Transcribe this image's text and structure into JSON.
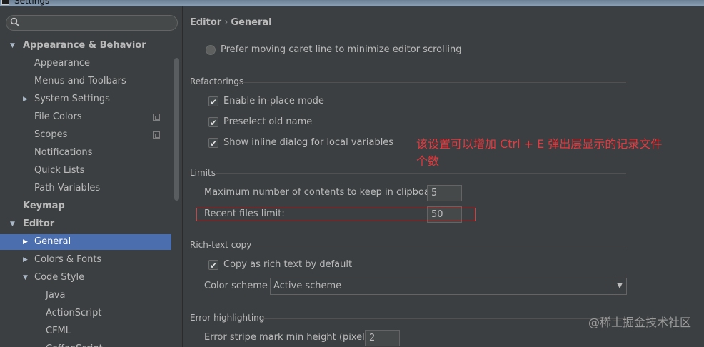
{
  "window": {
    "title": "Settings"
  },
  "search": {
    "placeholder": "",
    "icon": "search-icon"
  },
  "sidebar": {
    "items": [
      {
        "label": "Appearance & Behavior",
        "level": 0,
        "bold": true,
        "arrow": "▼"
      },
      {
        "label": "Appearance",
        "level": 1
      },
      {
        "label": "Menus and Toolbars",
        "level": 1
      },
      {
        "label": "System Settings",
        "level": 1,
        "arrow": "▶"
      },
      {
        "label": "File Colors",
        "level": 1,
        "icon": "copy-icon"
      },
      {
        "label": "Scopes",
        "level": 1,
        "icon": "copy-icon"
      },
      {
        "label": "Notifications",
        "level": 1
      },
      {
        "label": "Quick Lists",
        "level": 1
      },
      {
        "label": "Path Variables",
        "level": 1
      },
      {
        "label": "Keymap",
        "level": 0,
        "bold": true
      },
      {
        "label": "Editor",
        "level": 0,
        "bold": true,
        "arrow": "▼"
      },
      {
        "label": "General",
        "level": 1,
        "arrow": "▶",
        "selected": true
      },
      {
        "label": "Colors & Fonts",
        "level": 1,
        "arrow": "▶"
      },
      {
        "label": "Code Style",
        "level": 1,
        "arrow": "▼"
      },
      {
        "label": "Java",
        "level": 2
      },
      {
        "label": "ActionScript",
        "level": 2
      },
      {
        "label": "CFML",
        "level": 2
      },
      {
        "label": "CoffeeScript",
        "level": 2
      }
    ]
  },
  "breadcrumb": {
    "parent": "Editor",
    "separator": "›",
    "current": "General"
  },
  "main": {
    "prefer_caret": "Prefer moving caret line to minimize editor scrolling",
    "refactorings": {
      "title": "Refactorings",
      "options": [
        {
          "label": "Enable in-place mode",
          "checked": true
        },
        {
          "label": "Preselect old name",
          "checked": true
        },
        {
          "label": "Show inline dialog for local variables",
          "checked": true
        }
      ]
    },
    "limits": {
      "title": "Limits",
      "clipboard_label": "Maximum number of contents to keep in clipboard:",
      "clipboard_value": "5",
      "recent_label": "Recent files limit:",
      "recent_value": "50"
    },
    "rich_text": {
      "title": "Rich-text copy",
      "copy_label": "Copy as rich text by default",
      "copy_checked": true,
      "scheme_label": "Color scheme",
      "scheme_value": "Active scheme"
    },
    "error_highlighting": {
      "title": "Error highlighting",
      "stripe_label": "Error stripe mark min height (pixels):",
      "stripe_value": "2"
    }
  },
  "annotation": {
    "line1": "该设置可以增加 Ctrl + E 弹出层显示的记录文件",
    "line2": "个数"
  },
  "watermark": "@稀土掘金技术社区",
  "colors": {
    "selection": "#4b6eaf",
    "annotation": "#e8383d",
    "background": "#3c3f41"
  }
}
